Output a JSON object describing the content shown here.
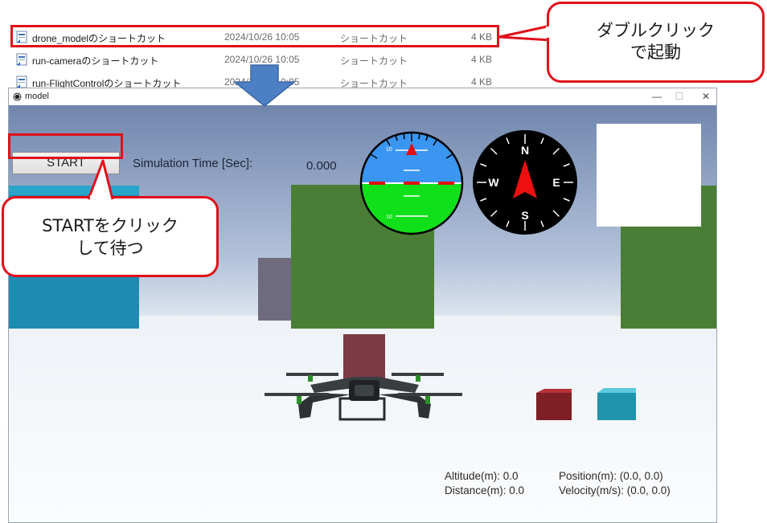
{
  "explorer": {
    "files": [
      {
        "name": "drone_modelのショートカット",
        "date": "2024/10/26 10:05",
        "type": "ショートカット",
        "size": "4 KB"
      },
      {
        "name": "run-cameraのショートカット",
        "date": "2024/10/26 10:05",
        "type": "ショートカット",
        "size": "4 KB"
      },
      {
        "name": "run-FlightControlのショートカット",
        "date": "2024/10/26 10:05",
        "type": "ショートカット",
        "size": "4 KB"
      }
    ]
  },
  "callouts": {
    "double_click": {
      "line1": "ダブルクリック",
      "line2": "で起動"
    },
    "start": {
      "line1": "STARTをクリック",
      "line2": "して待つ"
    }
  },
  "window": {
    "title": "model",
    "controls": {
      "minimize": "—",
      "maximize": "☐",
      "close": "✕"
    }
  },
  "app": {
    "start_label": "START",
    "sim_time_label": "Simulation Time [Sec]:",
    "sim_time_value": "0.000"
  },
  "attitude_indicator": {
    "tick_top": "10",
    "tick_bottom": "10"
  },
  "compass": {
    "n": "N",
    "e": "E",
    "s": "S",
    "w": "W"
  },
  "telemetry": {
    "altitude": "Altitude(m): 0.0",
    "distance": "Distance(m): 0.0",
    "position": "Position(m): (0.0, 0.0)",
    "velocity": "Velocity(m/s): (0.0, 0.0)"
  },
  "colors": {
    "highlight": "#e0101a",
    "sky_top": "#7185ab",
    "ground": "#f3f6fa",
    "sky_indicator": "#3a96f0",
    "ground_indicator": "#10e01a",
    "arrow": "#1e6fd0"
  },
  "icons": {
    "shortcut": "shortcut-file-icon",
    "window_logo": "unity-logo-icon",
    "down_arrow": "down-arrow-icon"
  }
}
